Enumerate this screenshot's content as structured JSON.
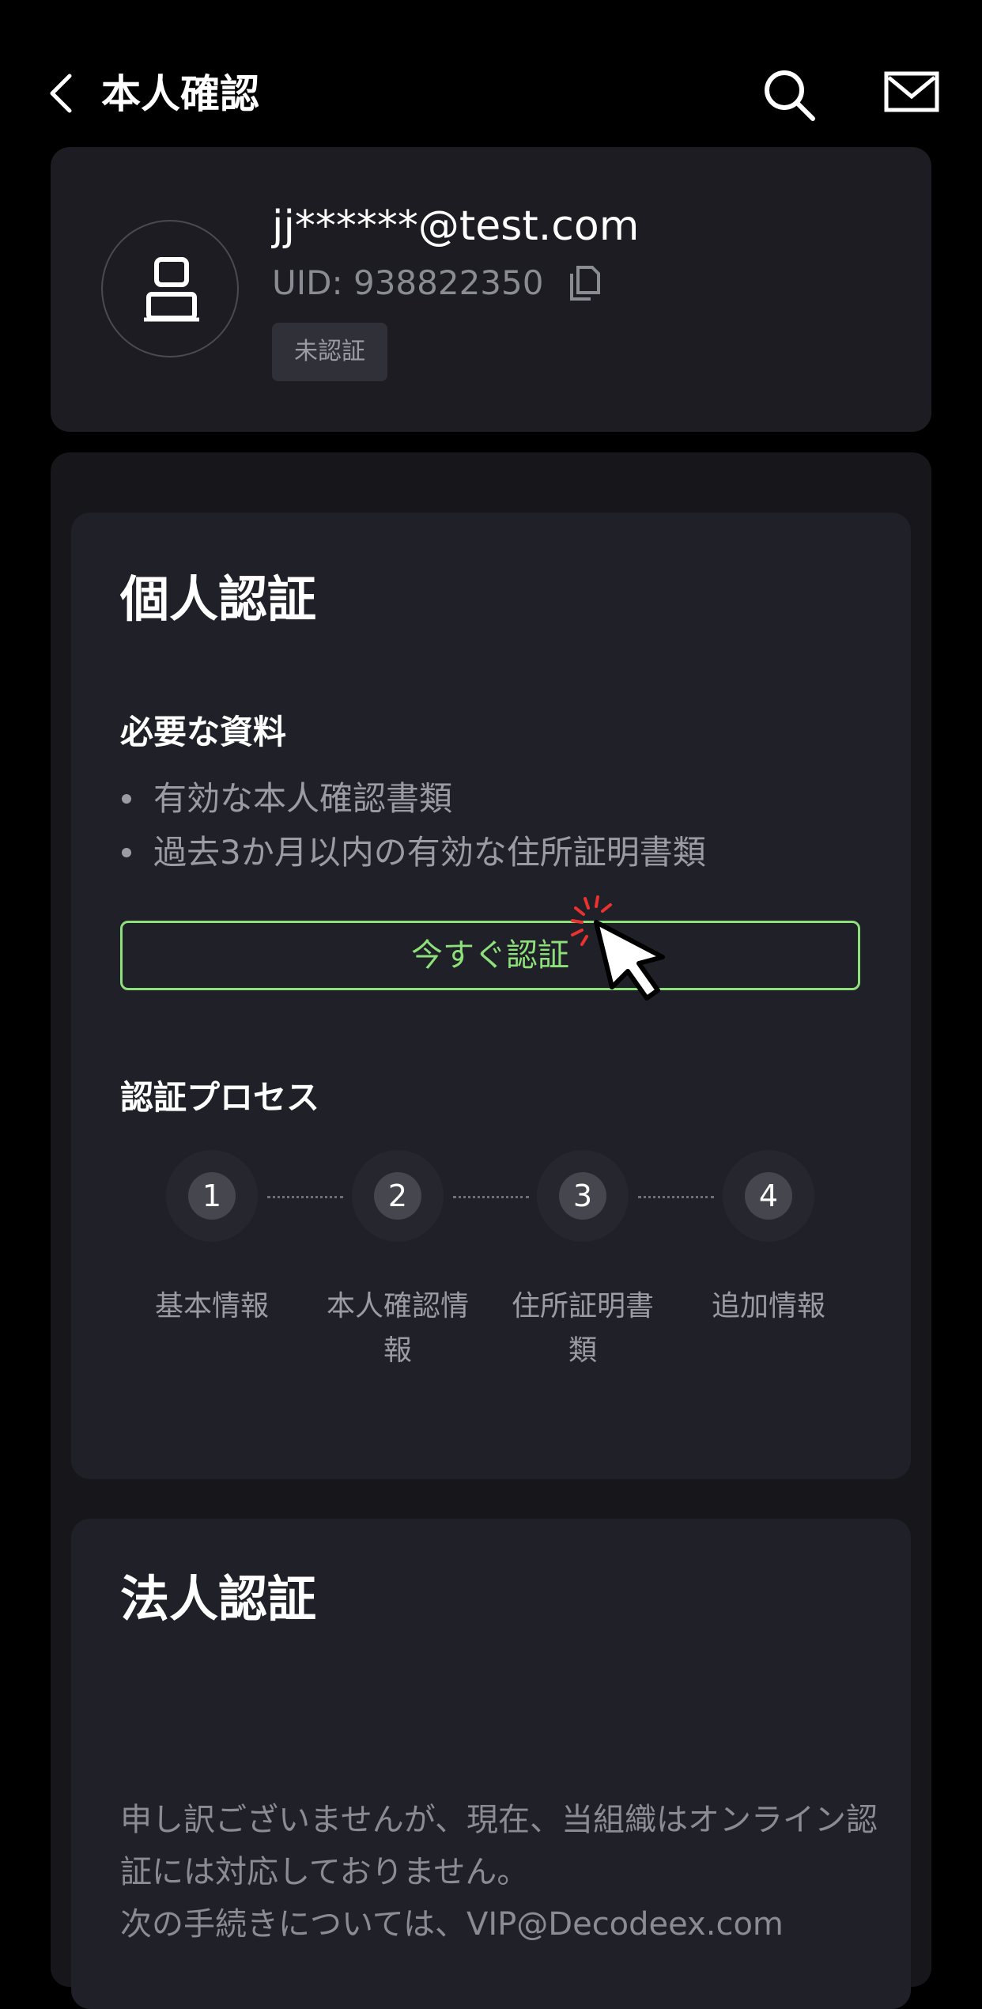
{
  "header": {
    "title": "本人確認"
  },
  "profile": {
    "email": "jj******@test.com",
    "uid": "UID: 938822350",
    "status": "未認証"
  },
  "personal": {
    "title": "個人認証",
    "required_heading": "必要な資料",
    "required_items": [
      "有効な本人確認書類",
      "過去3か月以内の有効な住所証明書類"
    ],
    "verify_button": "今すぐ認証",
    "process_heading": "認証プロセス",
    "steps": [
      {
        "number": "1",
        "label": "基本情報"
      },
      {
        "number": "2",
        "label": "本人確認情報"
      },
      {
        "number": "3",
        "label": "住所証明書類"
      },
      {
        "number": "4",
        "label": "追加情報"
      }
    ]
  },
  "corporate": {
    "title": "法人認証",
    "notice_line1": "申し訳ございませんが、現在、当組織はオンライン認証には対応しておりません。",
    "notice_line2": "次の手続きについては、VIP@Decodeex.com"
  },
  "colors": {
    "accent": "#8ee07a",
    "background": "#000000",
    "card": "#1c1c22"
  }
}
